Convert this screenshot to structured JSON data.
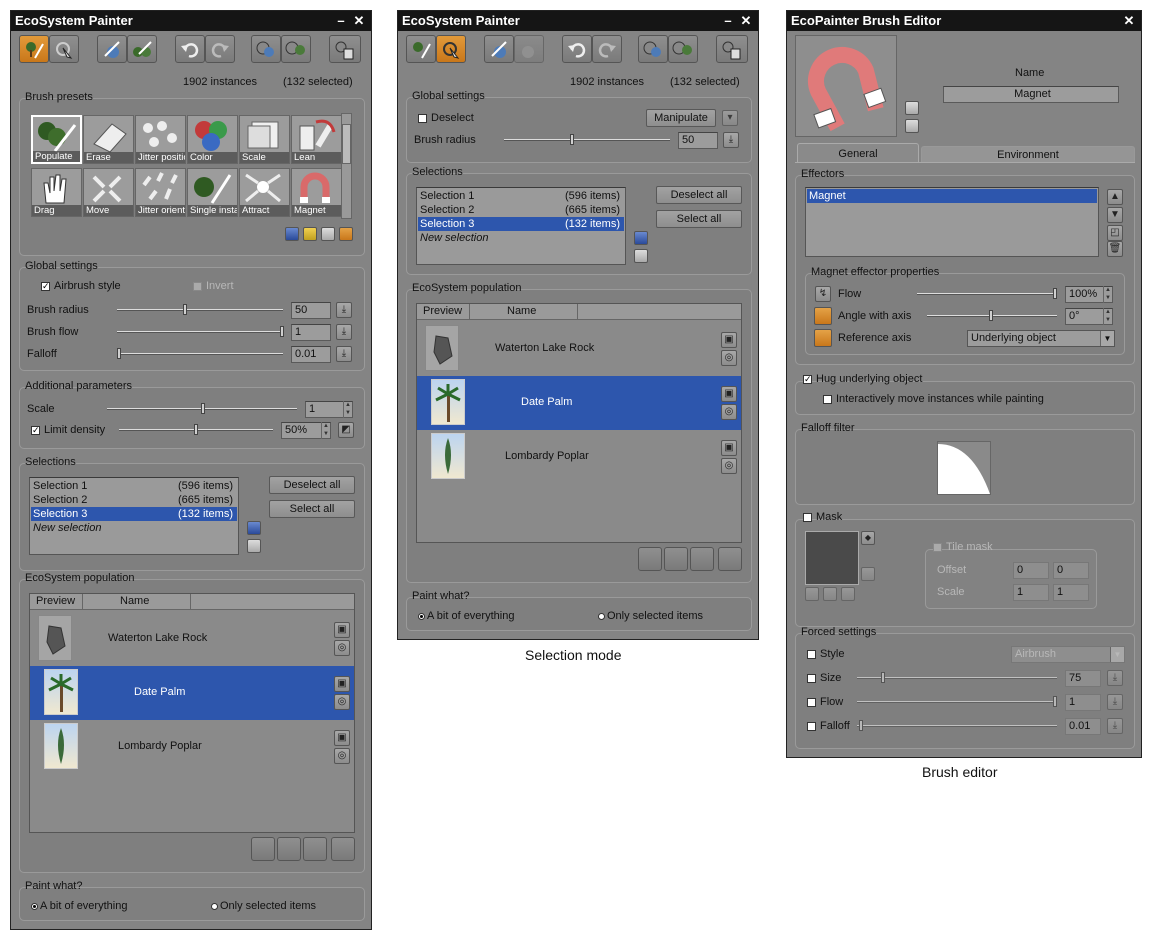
{
  "win1": {
    "title": "EcoSystem Painter",
    "minimize": "–",
    "close": "✕",
    "instances": "1902  instances",
    "selected": "(132 selected)",
    "brush_presets_title": "Brush presets",
    "presets": [
      "Populate",
      "Erase",
      "Jitter position",
      "Color",
      "Scale",
      "Lean",
      "Drag",
      "Move",
      "Jitter orient.",
      "Single instance",
      "Attract",
      "Magnet"
    ],
    "global_title": "Global settings",
    "airbrush_label": "Airbrush style",
    "invert_label": "Invert",
    "brush_radius_label": "Brush radius",
    "brush_radius_value": "50",
    "brush_flow_label": "Brush flow",
    "brush_flow_value": "1",
    "falloff_label": "Falloff",
    "falloff_value": "0.01",
    "additional_title": "Additional parameters",
    "scale_label": "Scale",
    "scale_value": "1",
    "limit_density_label": "Limit density",
    "limit_density_value": "50%",
    "selections_title": "Selections",
    "selections": [
      {
        "name": "Selection 1",
        "count": "(596 items)"
      },
      {
        "name": "Selection 2",
        "count": "(665 items)"
      },
      {
        "name": "Selection 3",
        "count": "(132 items)"
      }
    ],
    "new_selection": "New selection",
    "deselect_all": "Deselect all",
    "select_all": "Select all",
    "population_title": "EcoSystem population",
    "col_preview": "Preview",
    "col_name": "Name",
    "population": [
      "Waterton Lake Rock",
      "Date Palm",
      "Lombardy Poplar"
    ],
    "paint_what_title": "Paint what?",
    "opt_everything": "A bit of everything",
    "opt_selected": "Only selected items"
  },
  "win2": {
    "title": "EcoSystem Painter",
    "minimize": "–",
    "close": "✕",
    "instances": "1902  instances",
    "selected": "(132 selected)",
    "global_title": "Global settings",
    "deselect_label": "Deselect",
    "manipulate_label": "Manipulate",
    "brush_radius_label": "Brush radius",
    "brush_radius_value": "50",
    "selections_title": "Selections",
    "selections": [
      {
        "name": "Selection 1",
        "count": "(596 items)"
      },
      {
        "name": "Selection 2",
        "count": "(665 items)"
      },
      {
        "name": "Selection 3",
        "count": "(132 items)"
      }
    ],
    "new_selection": "New selection",
    "deselect_all": "Deselect all",
    "select_all": "Select all",
    "population_title": "EcoSystem population",
    "col_preview": "Preview",
    "col_name": "Name",
    "population": [
      "Waterton Lake Rock",
      "Date Palm",
      "Lombardy Poplar"
    ],
    "paint_what_title": "Paint what?",
    "opt_everything": "A bit of everything",
    "opt_selected": "Only selected items",
    "caption": "Selection mode"
  },
  "win3": {
    "title": "EcoPainter Brush Editor",
    "close": "✕",
    "name_label": "Name",
    "name_value": "Magnet",
    "tab_general": "General",
    "tab_environment": "Environment",
    "effectors_title": "Effectors",
    "effectors": [
      "Magnet"
    ],
    "magnet_props_title": "Magnet effector properties",
    "flow_label": "Flow",
    "flow_value": "100%",
    "angle_label": "Angle with axis",
    "angle_value": "0°",
    "ref_axis_label": "Reference axis",
    "ref_axis_value": "Underlying object",
    "hug_label": "Hug underlying object",
    "interactive_label": "Interactively move instances while painting",
    "falloff_filter_title": "Falloff filter",
    "mask_title": "Mask",
    "tile_mask_label": "Tile mask",
    "offset_label": "Offset",
    "offset_x": "0",
    "offset_y": "0",
    "scale_label": "Scale",
    "scale_x": "1",
    "scale_y": "1",
    "forced_title": "Forced settings",
    "style_label": "Style",
    "style_value": "Airbrush",
    "size_label": "Size",
    "size_value": "75",
    "flow2_label": "Flow",
    "flow2_value": "1",
    "falloff_label": "Falloff",
    "falloff_value": "0.01",
    "caption": "Brush editor"
  }
}
